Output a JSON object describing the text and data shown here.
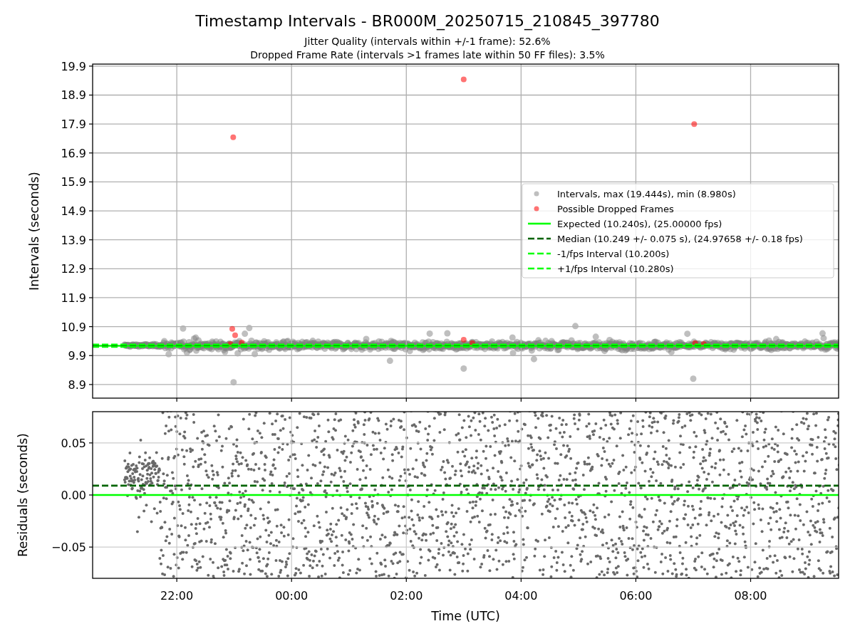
{
  "title": "Timestamp Intervals - BR000M_20250715_210845_397780",
  "subtitles": [
    "Jitter Quality (intervals within +/-1 frame): 52.6%",
    "Dropped Frame Rate (intervals >1 frames late within 50 FF files): 3.5%"
  ],
  "intervals_plot": {
    "chart_data": {
      "type": "scatter",
      "ylabel": "Intervals (seconds)",
      "grid": true,
      "xlim": [
        "2025-07-15T20:32",
        "2025-07-16T09:32"
      ],
      "ylim": [
        8.43,
        19.97
      ],
      "yticks": [
        {
          "value": 8.9,
          "label": "8.9"
        },
        {
          "value": 9.9,
          "label": "9.9"
        },
        {
          "value": 10.9,
          "label": "10.9"
        },
        {
          "value": 11.9,
          "label": "11.9"
        },
        {
          "value": 12.9,
          "label": "12.9"
        },
        {
          "value": 13.9,
          "label": "13.9"
        },
        {
          "value": 14.9,
          "label": "14.9"
        },
        {
          "value": 15.9,
          "label": "15.9"
        },
        {
          "value": 16.9,
          "label": "16.9"
        },
        {
          "value": 17.9,
          "label": "17.9"
        },
        {
          "value": 18.9,
          "label": "18.9"
        },
        {
          "value": 19.9,
          "label": "19.9"
        }
      ],
      "series": [
        {
          "name": "Intervals, max (19.444s), min (8.980s)",
          "type": "scatter",
          "color": "#808080"
        },
        {
          "name": "Possible Dropped Frames",
          "type": "scatter",
          "color": "#ff0000",
          "x": [
            "2025-07-15T22:59",
            "2025-07-15T22:58",
            "2025-07-15T23:01",
            "2025-07-15T23:08",
            "2025-07-15T22:56",
            "2025-07-16T03:00",
            "2025-07-16T03:00",
            "2025-07-16T03:09",
            "2025-07-16T07:01",
            "2025-07-16T07:02",
            "2025-07-16T07:11"
          ],
          "values": [
            17.44,
            10.82,
            10.6,
            10.35,
            10.3,
            19.44,
            10.45,
            10.33,
            17.9,
            10.33,
            10.3
          ]
        },
        {
          "name": "Expected (10.240s), (25.00000 fps)",
          "type": "line",
          "color": "#00ff00",
          "x": [
            "2025-07-15T20:32",
            "2025-07-16T09:32"
          ],
          "values": [
            10.24,
            10.24
          ]
        },
        {
          "name": "Median (10.249 +/- 0.075 s), (24.97658 +/- 0.18 fps)",
          "type": "line",
          "line_style": "dashed",
          "color": "#006400",
          "x": [
            "2025-07-15T20:32",
            "2025-07-16T09:32"
          ],
          "values": [
            10.25,
            10.25
          ]
        },
        {
          "name": "-1/fps Interval (10.200s)",
          "type": "line",
          "line_style": "dashed",
          "color": "#00ff00",
          "x": [
            "2025-07-15T20:32",
            "2025-07-16T09:32"
          ],
          "values": [
            10.2,
            10.2
          ]
        },
        {
          "name": "+1/fps Interval (10.280s)",
          "type": "line",
          "line_style": "dashed",
          "color": "#00ff00",
          "x": [
            "2025-07-15T20:32",
            "2025-07-16T09:32"
          ],
          "values": [
            10.28,
            10.28
          ]
        }
      ]
    }
  },
  "residuals_plot": {
    "chart_data": {
      "type": "scatter",
      "xlabel": "Time (UTC)",
      "ylabel": "Residuals (seconds)",
      "grid": true,
      "xlim": [
        "2025-07-15T20:32",
        "2025-07-16T09:32"
      ],
      "ylim": [
        -0.08,
        0.08
      ],
      "xticks": [
        {
          "value": "2025-07-15T22:00",
          "label": "22:00"
        },
        {
          "value": "2025-07-16T00:00",
          "label": "00:00"
        },
        {
          "value": "2025-07-16T02:00",
          "label": "02:00"
        },
        {
          "value": "2025-07-16T04:00",
          "label": "04:00"
        },
        {
          "value": "2025-07-16T06:00",
          "label": "06:00"
        },
        {
          "value": "2025-07-16T08:00",
          "label": "08:00"
        }
      ],
      "yticks": [
        {
          "value": 0.05,
          "label": "0.05"
        },
        {
          "value": 0,
          "label": "0.00"
        },
        {
          "value": -0.05,
          "label": "−0.05"
        }
      ],
      "series": [
        {
          "type": "scatter",
          "color": "#696969"
        },
        {
          "type": "line",
          "line_style": "dashed",
          "color": "#006400",
          "x": [
            "2025-07-15T20:32",
            "2025-07-16T09:32"
          ],
          "values": [
            0.009,
            0.009
          ]
        },
        {
          "type": "line",
          "color": "#00ff00",
          "x": [
            "2025-07-15T20:32",
            "2025-07-16T09:32"
          ],
          "values": [
            0,
            0
          ]
        }
      ]
    }
  }
}
